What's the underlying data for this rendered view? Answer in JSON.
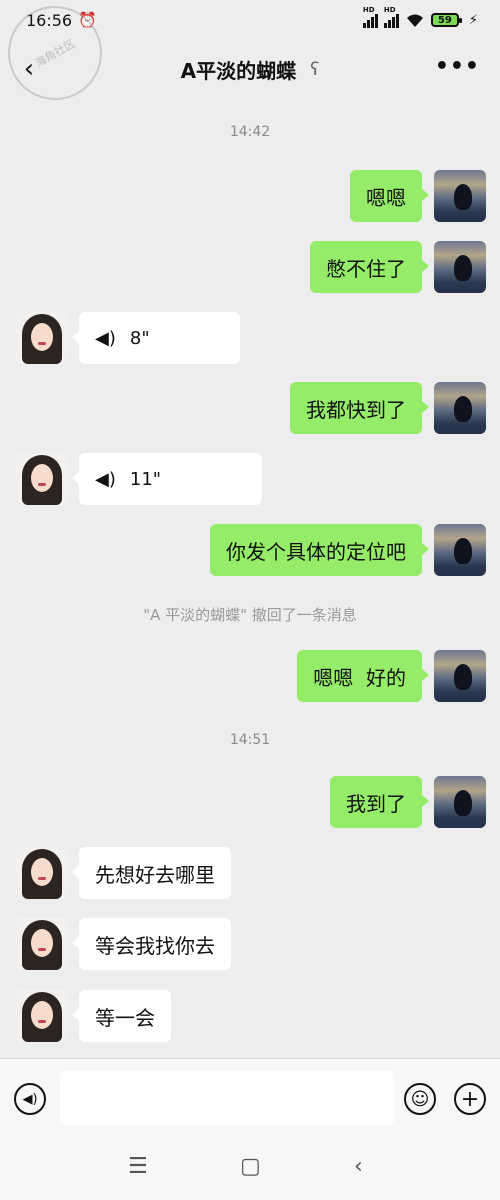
{
  "status_bar": {
    "time": "16:56",
    "alarm_icon": "alarm-icon",
    "signal1_label": "HD",
    "signal2_label": "HD",
    "wifi_icon": "wifi-icon",
    "battery_level": "59",
    "charging_icon": "charging-icon"
  },
  "header": {
    "title": "A平淡的蝴蝶",
    "back_icon": "back-chevron-icon",
    "ear_icon": "earpiece-icon",
    "more_label": "•••"
  },
  "messages": [
    {
      "type": "time",
      "text": "14:42"
    },
    {
      "type": "text",
      "from": "me",
      "text": "嗯嗯"
    },
    {
      "type": "text",
      "from": "me",
      "text": "憋不住了"
    },
    {
      "type": "voice",
      "from": "her",
      "duration": "8\""
    },
    {
      "type": "text",
      "from": "me",
      "text": "我都快到了"
    },
    {
      "type": "voice",
      "from": "her",
      "duration": "11\""
    },
    {
      "type": "text",
      "from": "me",
      "text": "你发个具体的定位吧"
    },
    {
      "type": "recall",
      "text": "\"A 平淡的蝴蝶\" 撤回了一条消息"
    },
    {
      "type": "text",
      "from": "me",
      "text": "嗯嗯  好的"
    },
    {
      "type": "time",
      "text": "14:51"
    },
    {
      "type": "text",
      "from": "me",
      "text": "我到了"
    },
    {
      "type": "text",
      "from": "her",
      "text": "先想好去哪里"
    },
    {
      "type": "text",
      "from": "her",
      "text": "等会我找你去"
    },
    {
      "type": "text",
      "from": "her",
      "text": "等一会"
    }
  ],
  "input_bar": {
    "voice_icon": "voice-input-icon",
    "input_value": "",
    "emoji_icon": "emoji-icon",
    "plus_icon": "plus-icon"
  },
  "nav_bar": {
    "menu_icon": "menu-icon",
    "home_icon": "home-icon",
    "back_icon": "back-icon"
  },
  "colors": {
    "background": "#ededed",
    "my_bubble": "#95ec69",
    "her_bubble": "#ffffff"
  }
}
